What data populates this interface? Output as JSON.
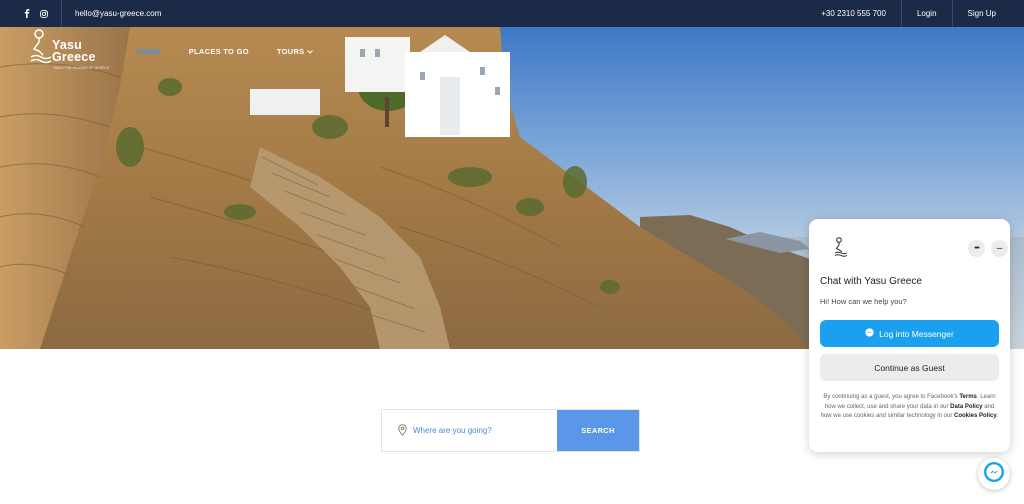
{
  "topbar": {
    "social_icons": [
      "facebook-icon",
      "instagram-icon"
    ],
    "email": "hello@yasu-greece.com",
    "phone": "+30 2310 555 700",
    "login": "Login",
    "signup": "Sign Up",
    "background": "#1a2a47"
  },
  "nav": {
    "logo_line1": "Yasu",
    "logo_line2": "Greece",
    "logo_tagline": "WALK THE ISLANDS OF GREECE",
    "items": [
      {
        "label": "HOME",
        "active": true
      },
      {
        "label": "PLACES TO GO",
        "active": false
      },
      {
        "label": "TOURS",
        "active": false,
        "dropdown": true
      }
    ],
    "active_color": "#4f8fe0"
  },
  "search": {
    "placeholder": "Where are you going?",
    "button": "SEARCH",
    "button_color": "#5a97e8"
  },
  "chat": {
    "title": "Chat with Yasu Greece",
    "greeting": "Hi! How can we help you?",
    "messenger_button": "Log into Messenger",
    "guest_button": "Continue as Guest",
    "more_label": "•••",
    "minimize_label": "–",
    "legal": {
      "p1": "By continuing as a guest, you agree to Facebook's ",
      "terms": "Terms",
      "p2": ". Learn how we collect, use and share your data in our ",
      "data_policy": "Data Policy",
      "p3": " and how we use cookies and similar technology in our ",
      "cookies_policy": "Cookies Policy",
      "p4": "."
    },
    "messenger_color": "#1aa0ef"
  }
}
